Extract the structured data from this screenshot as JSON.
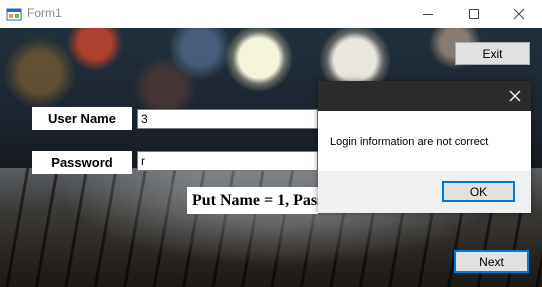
{
  "window": {
    "title": "Form1",
    "icons": {
      "app": "winforms-app-icon",
      "minimize": "minimize-icon",
      "maximize": "maximize-icon",
      "close": "close-icon"
    }
  },
  "form": {
    "username_label": "User Name",
    "username_value": "3",
    "password_label": "Password",
    "password_value": "r",
    "hint_text": "Put Name = 1, Pass",
    "exit_button": "Exit",
    "next_button": "Next"
  },
  "dialog": {
    "message": "Login information are not correct",
    "ok_button": "OK",
    "icons": {
      "close": "close-icon"
    }
  },
  "colors": {
    "accent": "#0078d7",
    "dialog_titlebar": "#2b2b2b",
    "button_face": "#e1e1e1"
  }
}
